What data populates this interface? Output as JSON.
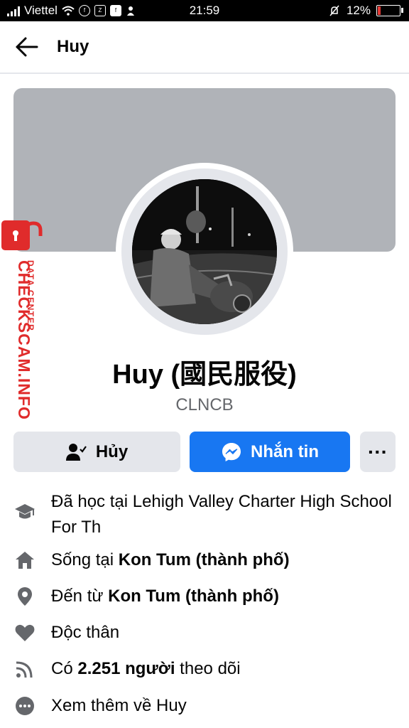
{
  "status_bar": {
    "carrier": "Viettel",
    "time": "21:59",
    "battery": "12%"
  },
  "header": {
    "title": "Huy"
  },
  "profile": {
    "name": "Huy (國民服役)",
    "nickname": "CLNCB"
  },
  "actions": {
    "unfollow_label": "Hủy",
    "message_label": "Nhắn tin",
    "more_label": "···"
  },
  "details": {
    "education": "Đã học tại Lehigh Valley Charter High School For Th",
    "lives_prefix": "Sống tại ",
    "lives_city": "Kon Tum (thành phố)",
    "from_prefix": "Đến từ ",
    "from_city": "Kon Tum (thành phố)",
    "relationship": "Độc thân",
    "followers_prefix": "Có ",
    "followers_count": "2.251 người",
    "followers_suffix": " theo dõi",
    "see_more": "Xem thêm về Huy"
  },
  "watermark": {
    "line1": "DATA CENTER",
    "line2": "CHECKSCAM.INFO"
  },
  "colors": {
    "accent": "#1877f2",
    "watermark_red": "#e02b2b",
    "cover_gray": "#b0b3b8"
  }
}
